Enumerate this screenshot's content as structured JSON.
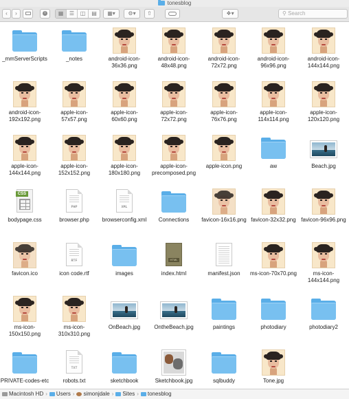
{
  "window": {
    "title": "tonesblog"
  },
  "toolbar": {
    "back_icon": "chevron-left",
    "forward_icon": "chevron-right",
    "search_placeholder": "Search"
  },
  "files": [
    {
      "name": "_mmServerScripts",
      "kind": "folder"
    },
    {
      "name": "_notes",
      "kind": "folder"
    },
    {
      "name": "android-icon-36x36.png",
      "kind": "face"
    },
    {
      "name": "android-icon-48x48.png",
      "kind": "face"
    },
    {
      "name": "android-icon-72x72.png",
      "kind": "face"
    },
    {
      "name": "android-icon-96x96.png",
      "kind": "face"
    },
    {
      "name": "android-icon-144x144.png",
      "kind": "face"
    },
    {
      "name": "android-icon-192x192.png",
      "kind": "face"
    },
    {
      "name": "apple-icon-57x57.png",
      "kind": "face"
    },
    {
      "name": "apple-icon-60x60.png",
      "kind": "face"
    },
    {
      "name": "apple-icon-72x72.png",
      "kind": "face"
    },
    {
      "name": "apple-icon-76x76.png",
      "kind": "face"
    },
    {
      "name": "apple-icon-114x114.png",
      "kind": "face"
    },
    {
      "name": "apple-icon-120x120.png",
      "kind": "face"
    },
    {
      "name": "apple-icon-144x144.png",
      "kind": "face"
    },
    {
      "name": "apple-icon-152x152.png",
      "kind": "face"
    },
    {
      "name": "apple-icon-180x180.png",
      "kind": "face"
    },
    {
      "name": "apple-icon-precomposed.png",
      "kind": "face"
    },
    {
      "name": "apple-icon.png",
      "kind": "face"
    },
    {
      "name": "aw",
      "kind": "folder"
    },
    {
      "name": "Beach.jpg",
      "kind": "beach"
    },
    {
      "name": "bodypage.css",
      "kind": "css"
    },
    {
      "name": "browser.php",
      "kind": "doc",
      "ext": "PHP"
    },
    {
      "name": "browserconfig.xml",
      "kind": "doc",
      "ext": "XML"
    },
    {
      "name": "Connections",
      "kind": "folder"
    },
    {
      "name": "favicon-16x16.png",
      "kind": "face-blur"
    },
    {
      "name": "favicon-32x32.png",
      "kind": "face"
    },
    {
      "name": "favicon-96x96.png",
      "kind": "face"
    },
    {
      "name": "favicon.ico",
      "kind": "face-blur"
    },
    {
      "name": "icon code.rtf",
      "kind": "doc",
      "ext": "RTF"
    },
    {
      "name": "images",
      "kind": "folder"
    },
    {
      "name": "index.html",
      "kind": "html"
    },
    {
      "name": "manifest.json",
      "kind": "json"
    },
    {
      "name": "ms-icon-70x70.png",
      "kind": "face"
    },
    {
      "name": "ms-icon-144x144.png",
      "kind": "face"
    },
    {
      "name": "ms-icon-150x150.png",
      "kind": "face"
    },
    {
      "name": "ms-icon-310x310.png",
      "kind": "face"
    },
    {
      "name": "OnBeach.jpg",
      "kind": "beach"
    },
    {
      "name": "OntheBeach.jpg",
      "kind": "beach"
    },
    {
      "name": "paintings",
      "kind": "folder"
    },
    {
      "name": "photodiary",
      "kind": "folder"
    },
    {
      "name": "photodiary2",
      "kind": "folder"
    },
    {
      "name": "PRIVATE-codes-etc",
      "kind": "folder"
    },
    {
      "name": "robots.txt",
      "kind": "doc",
      "ext": "TXT"
    },
    {
      "name": "sketchbook",
      "kind": "folder"
    },
    {
      "name": "Sketchbook.jpg",
      "kind": "photo"
    },
    {
      "name": "sqlbuddy",
      "kind": "folder"
    },
    {
      "name": "Tone.jpg",
      "kind": "face"
    }
  ],
  "pathbar": [
    {
      "label": "Macintosh HD",
      "icon": "disk-icon"
    },
    {
      "label": "Users",
      "icon": "folder-icon"
    },
    {
      "label": "simonjdale",
      "icon": "home-icon"
    },
    {
      "label": "Sites",
      "icon": "folder-icon"
    },
    {
      "label": "tonesblog",
      "icon": "folder-icon"
    }
  ],
  "colors": {
    "folder": "#5aaee8",
    "folder_light": "#78c0f0"
  }
}
